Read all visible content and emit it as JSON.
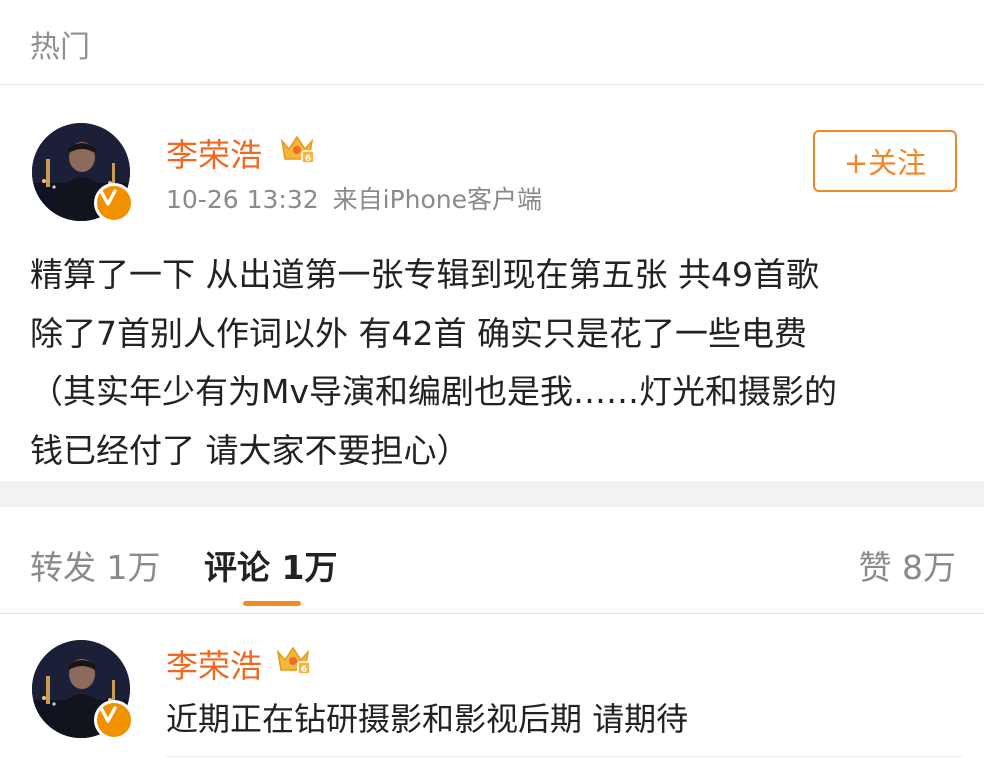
{
  "header": {
    "title": "热门"
  },
  "post": {
    "author": {
      "name": "李荣浩"
    },
    "time": "10-26 13:32",
    "source": "来自iPhone客户端",
    "follow_label": "+关注",
    "lines": [
      "精算了一下 从出道第一张专辑到现在第五张 共49首歌",
      "除了7首别人作词以外 有42首 确实只是花了一些电费",
      "（其实年少有为Mv导演和编剧也是我……灯光和摄影的",
      "钱已经付了 请大家不要担心）"
    ]
  },
  "tabs": {
    "repost": "转发 1万",
    "comment": "评论 1万",
    "like": "赞 8万",
    "active": "comment"
  },
  "comment": {
    "author": {
      "name": "李荣浩"
    },
    "text": "近期正在钻研摄影和影视后期 请期待"
  },
  "colors": {
    "username": "#f0671e",
    "accent": "#f0862a",
    "verified": "#f29100",
    "crown": "#f4b63c"
  },
  "icons": {
    "verified": "verified-v-icon",
    "member": "crown-icon"
  }
}
